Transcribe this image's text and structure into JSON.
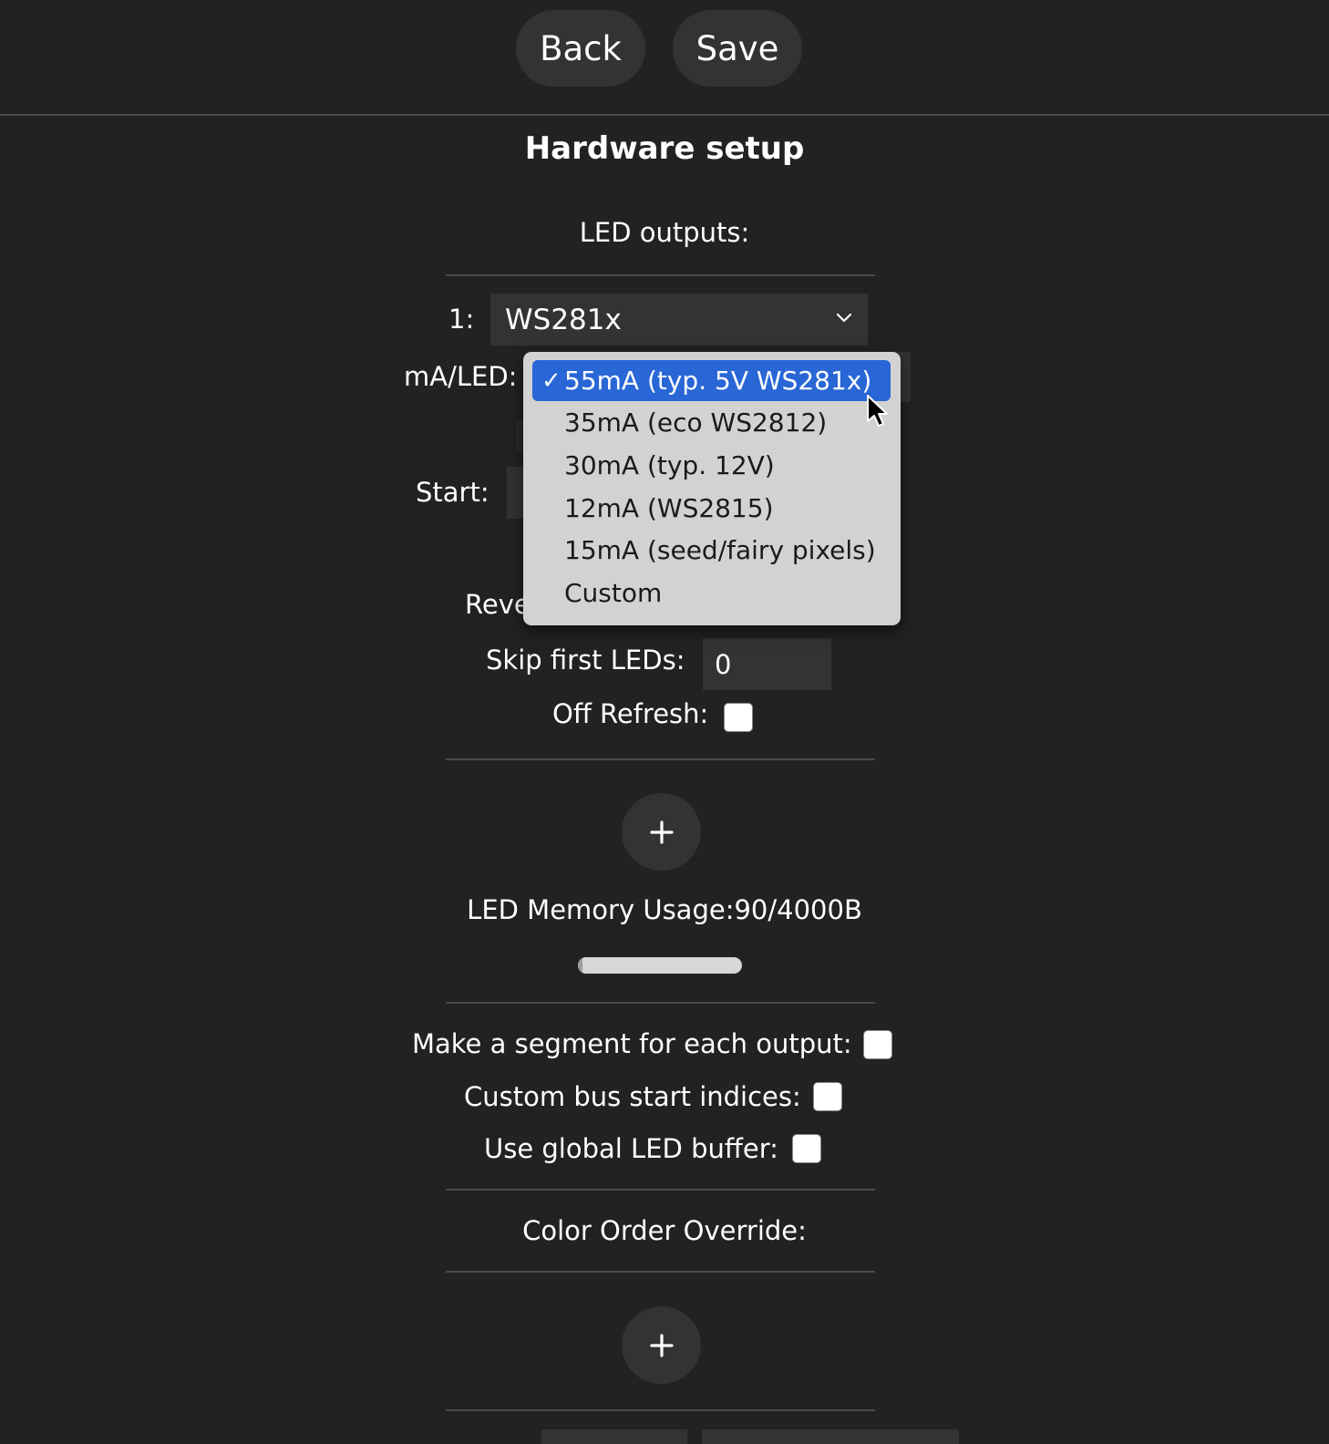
{
  "toolbar": {
    "back_label": "Back",
    "save_label": "Save"
  },
  "page_title": "Hardware setup",
  "led_outputs": {
    "heading": "LED outputs:",
    "output_index_label": "1:",
    "led_type_value": "WS281x",
    "ma_per_led_label": "mA/LED:",
    "start_label": "Start:",
    "reverse_label_partial": "Reve",
    "skip_first_label": "Skip first LEDs:",
    "skip_first_value": "0",
    "off_refresh_label": "Off Refresh:",
    "off_refresh_checked": false
  },
  "ma_dropdown": {
    "selected_index": 0,
    "options": [
      "55mA (typ. 5V WS281x)",
      "35mA (eco WS2812)",
      "30mA (typ. 12V)",
      "12mA (WS2815)",
      "15mA (seed/fairy pixels)",
      "Custom"
    ],
    "selected_color": "#2966d6"
  },
  "add_output_symbol": "+",
  "memory": {
    "label": "LED Memory Usage:90/4000B",
    "used": 90,
    "total": 4000
  },
  "options": {
    "segment_per_output_label": "Make a segment for each output:",
    "segment_per_output_checked": false,
    "custom_bus_label": "Custom bus start indices:",
    "custom_bus_checked": false,
    "global_buffer_label": "Use global LED buffer:",
    "global_buffer_checked": false
  },
  "color_order": {
    "heading": "Color Order Override:",
    "add_symbol": "+"
  },
  "icons": {
    "select_chevron": "chevron-down-icon",
    "checkmark": "checkmark-icon",
    "cursor": "mouse-pointer-icon",
    "plus": "plus-icon"
  }
}
